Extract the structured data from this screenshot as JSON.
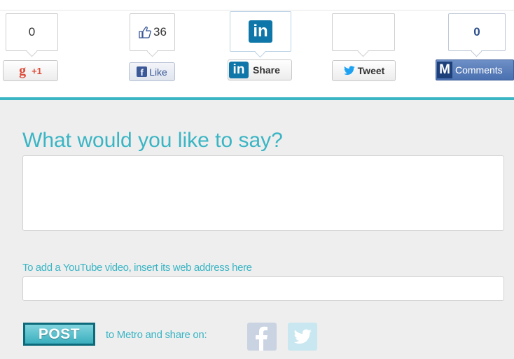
{
  "share_bar": {
    "gplus": {
      "count": "0",
      "glyph": "g",
      "label": "+1",
      "icon": "google-plus-icon"
    },
    "facebook": {
      "count": "36",
      "glyph": "f",
      "label": "Like",
      "icon": "facebook-like-icon"
    },
    "linkedin": {
      "logo": "in",
      "label": "Share",
      "icon": "linkedin-icon"
    },
    "twitter": {
      "count": "",
      "label": "Tweet",
      "icon": "twitter-bird-icon"
    },
    "comments": {
      "count": "0",
      "glyph": "M",
      "label": "Comments",
      "icon": "metro-comments-icon"
    }
  },
  "form": {
    "heading": "What would you like to say?",
    "comment_value": "",
    "youtube_label": "To add a YouTube video, insert its web address here",
    "youtube_value": "",
    "post_label": "POST",
    "share_text": "to Metro and share on:",
    "share_icons": [
      "facebook-icon",
      "twitter-icon"
    ]
  },
  "colors": {
    "accent": "#3ab5c4",
    "post_border": "#0c6a7a",
    "google_red": "#dd4b39",
    "facebook_blue": "#3b5998",
    "linkedin_blue": "#0e76a8",
    "twitter_blue": "#1da1f2",
    "metro_blue": "#4a70b0"
  }
}
